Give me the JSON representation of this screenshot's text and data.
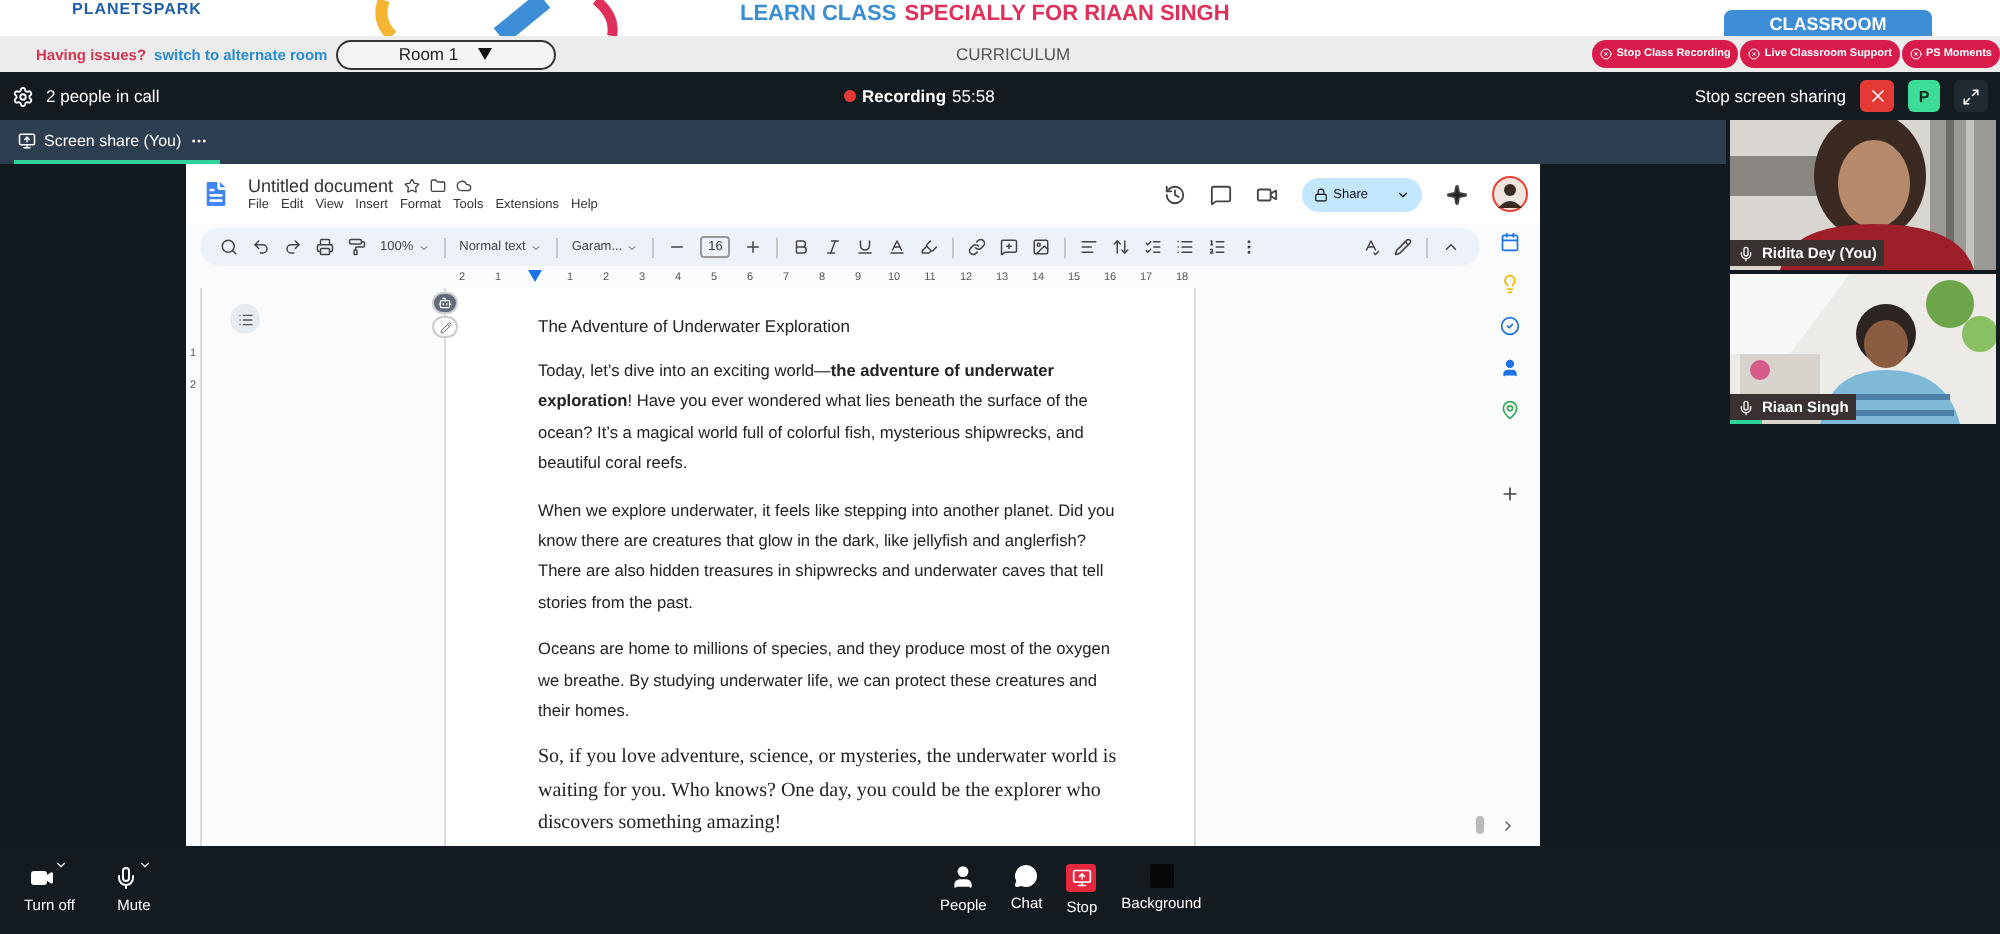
{
  "banner": {
    "logo": "PLANETSPARK",
    "title_lead": "LEARN CLASS",
    "title_rest": "SPECIALLY FOR RIAAN SINGH",
    "tab": "CLASSROOM"
  },
  "issues_bar": {
    "prompt": "Having issues?",
    "link": "switch to alternate room",
    "room_select": "Room 1",
    "center_label": "CURRICULUM",
    "buttons": [
      "Stop Class Recording",
      "Live Classroom Support",
      "PS Moments"
    ]
  },
  "call_bar": {
    "people_count": "2 people in call",
    "recording": {
      "on": true,
      "label": "Recording",
      "time": "55:58"
    },
    "stop_share": "Stop screen sharing",
    "avatar_letter": "P"
  },
  "tabs": [
    {
      "label": "Screen share (You)",
      "selected": true
    }
  ],
  "document": {
    "title": "Untitled document",
    "menu": [
      "File",
      "Edit",
      "View",
      "Insert",
      "Format",
      "Tools",
      "Extensions",
      "Help"
    ],
    "share": "Share",
    "zoom": "100%",
    "style": "Normal text",
    "font": "Garam...",
    "font_size": "16",
    "ruler": [
      "2",
      "1",
      "1",
      "2",
      "3",
      "4",
      "5",
      "6",
      "7",
      "8",
      "9",
      "10",
      "11",
      "12",
      "13",
      "14",
      "15",
      "16",
      "17",
      "18"
    ],
    "vertical_ruler": [
      "1",
      "2"
    ],
    "heading": "The Adventure of Underwater Exploration",
    "paragraphs": [
      {
        "kind": "sans",
        "text": "Today, let’s dive into an exciting world—**the adventure of underwater exploration**! Have you ever wondered what lies beneath the surface of the ocean? It’s a magical world full of colorful fish, mysterious shipwrecks, and beautiful coral reefs."
      },
      {
        "kind": "sans",
        "text": "When we explore underwater, it feels like stepping into another planet. Did you know there are creatures that glow in the dark, like jellyfish and anglerfish? There are also hidden treasures in shipwrecks and underwater caves that tell stories from the past."
      },
      {
        "kind": "sans",
        "text": "Oceans are home to millions of species, and they produce most of the oxygen we breathe. By studying underwater life, we can protect these creatures and their homes."
      },
      {
        "kind": "serif",
        "text": "So, if you love adventure, science, or mysteries, the underwater world is waiting for you. Who knows? One day, you could be the explorer who discovers something amazing!"
      }
    ]
  },
  "participants": [
    {
      "name": "Ridita Dey (You)",
      "speaking": false
    },
    {
      "name": "Riaan Singh",
      "speaking": true
    }
  ],
  "left_controls": [
    {
      "kind": "camera",
      "label": "Turn off"
    },
    {
      "kind": "mic",
      "label": "Mute"
    }
  ],
  "center_controls": [
    {
      "kind": "people",
      "label": "People"
    },
    {
      "kind": "chat",
      "label": "Chat"
    },
    {
      "kind": "stop",
      "label": "Stop"
    },
    {
      "kind": "background",
      "label": "Background"
    }
  ]
}
